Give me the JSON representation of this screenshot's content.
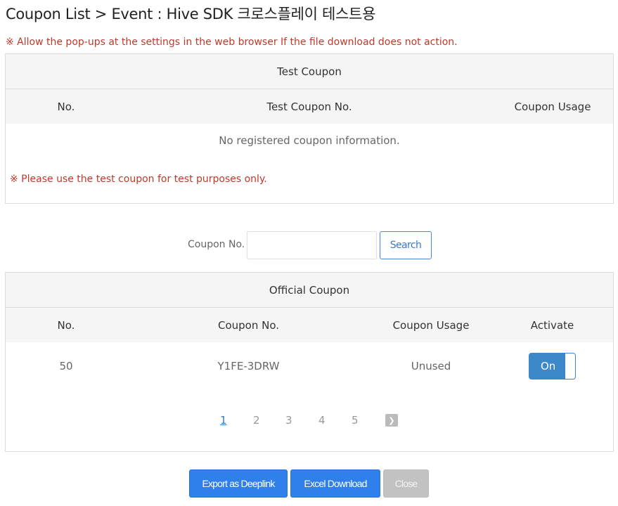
{
  "page": {
    "title": "Coupon List > Event : Hive SDK 크로스플레이 테스트용",
    "popup_notice": "※ Allow the pop-ups at the settings in the web browser If the file download does not action."
  },
  "test_coupon": {
    "heading": "Test Coupon",
    "columns": [
      "No.",
      "Test Coupon No.",
      "Coupon Usage"
    ],
    "empty_message": "No registered coupon information.",
    "note": "※ Please use the test coupon for test purposes only."
  },
  "search": {
    "label": "Coupon No.",
    "value": "",
    "placeholder": "",
    "button_label": "Search"
  },
  "official_coupon": {
    "heading": "Official Coupon",
    "columns": [
      "No.",
      "Coupon No.",
      "Coupon Usage",
      "Activate"
    ],
    "rows": [
      {
        "no": "50",
        "coupon_no": "Y1FE-3DRW",
        "usage": "Unused",
        "activate": "On"
      }
    ],
    "pagination": {
      "pages": [
        "1",
        "2",
        "3",
        "4",
        "5"
      ],
      "current": "1",
      "next_icon": "chevron-right-icon"
    }
  },
  "actions": {
    "export_deeplink": "Export as Deeplink",
    "excel_download": "Excel Download",
    "close": "Close"
  },
  "colors": {
    "accent_blue": "#2f80ed",
    "notice_red": "#c0392b",
    "toggle_on": "#3d88c9",
    "disabled_gray": "#c2c2c2"
  }
}
